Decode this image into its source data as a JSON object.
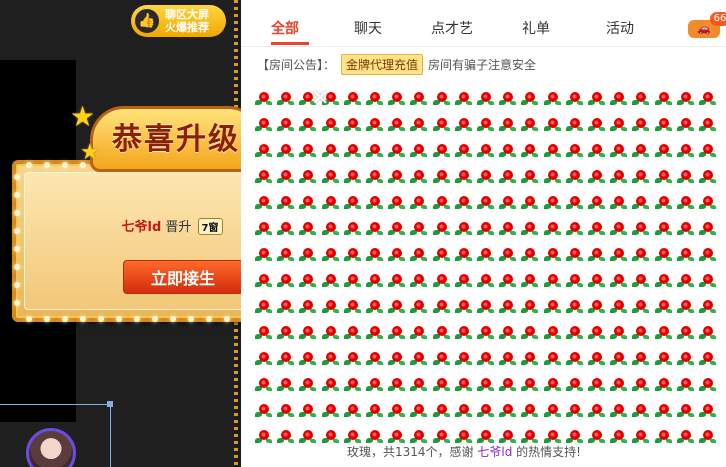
{
  "left": {
    "bigscreen": {
      "line1": "聊区大屏",
      "line2": "火爆推荐",
      "icon": "thumbs-up-icon"
    }
  },
  "popup": {
    "title": "恭喜升级",
    "username": "七爷ld",
    "action": "晋升",
    "level": "7窗",
    "button": "立即接生"
  },
  "tabs": [
    {
      "label": "全部"
    },
    {
      "label": "聊天"
    },
    {
      "label": "点才艺"
    },
    {
      "label": "礼单"
    },
    {
      "label": "活动"
    }
  ],
  "car": {
    "badge": "66",
    "icon": "car-icon"
  },
  "notice": {
    "label": "【房间公告】：",
    "tag": "金牌代理充值",
    "text": "房间有骗子注意安全"
  },
  "gift_line": {
    "prefix": "玫瑰，共1314个，感谢",
    "user": "七爷ld",
    "suffix": "的热情支持!"
  },
  "colors": {
    "accent": "#e6452f",
    "gold": "#f2a600",
    "rose": "#e00000"
  }
}
